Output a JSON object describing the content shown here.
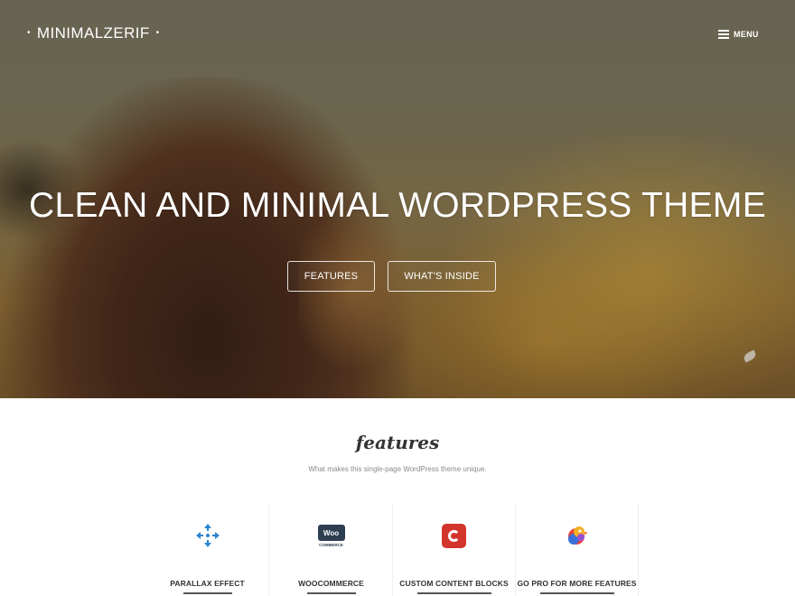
{
  "header": {
    "logo_text": "MINIMALZERIF",
    "logo_dot": "•",
    "menu_label": "MENU"
  },
  "hero": {
    "title": "CLEAN AND MINIMAL WORDPRESS THEME",
    "buttons": [
      {
        "label": "FEATURES"
      },
      {
        "label": "WHAT'S INSIDE"
      }
    ]
  },
  "features_section": {
    "title": "features",
    "subtitle": "What makes this single-page WordPress theme unique.",
    "cards": [
      {
        "label": "PARALLAX EFFECT",
        "icon": "parallax-arrows-icon"
      },
      {
        "label": "WOOCOMMERCE",
        "icon": "woocommerce-logo-icon",
        "icon_text": "Woo",
        "icon_subtext": "COMMERCE"
      },
      {
        "label": "CUSTOM CONTENT BLOCKS",
        "icon": "custom-content-blocks-icon"
      },
      {
        "label": "GO PRO FOR MORE FEATURES",
        "icon": "colorful-bird-icon"
      }
    ]
  },
  "colors": {
    "accent_blue": "#2a86d1",
    "woo_dark": "#2d3e50",
    "content_red": "#d3352c",
    "text_dark": "#333333",
    "text_muted": "#8a8a8a"
  }
}
